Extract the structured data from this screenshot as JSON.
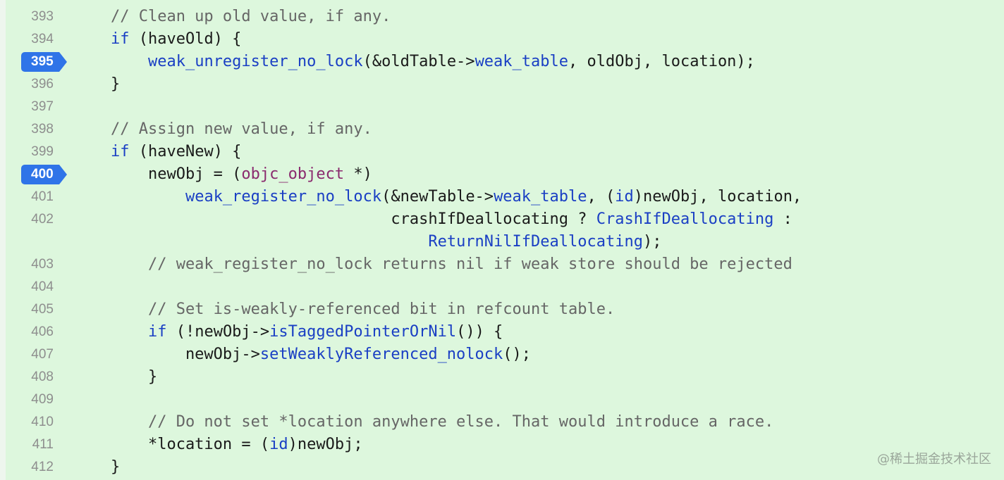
{
  "colors": {
    "background": "#ddf7dd",
    "breakpoint": "#2f74e8",
    "comment": "#666666",
    "keyword": "#1a3fc4",
    "type": "#8a2a6e",
    "line_number": "#8e8e8e"
  },
  "lines": [
    {
      "num": "393",
      "breakpoint": false,
      "tokens": [
        {
          "t": "    // Clean up old value, if any.",
          "c": "cm"
        }
      ]
    },
    {
      "num": "394",
      "breakpoint": false,
      "tokens": [
        {
          "t": "    "
        },
        {
          "t": "if",
          "c": "kw"
        },
        {
          "t": " (haveOld) {"
        }
      ]
    },
    {
      "num": "395",
      "breakpoint": true,
      "tokens": [
        {
          "t": "        "
        },
        {
          "t": "weak_unregister_no_lock",
          "c": "fn"
        },
        {
          "t": "(&oldTable->"
        },
        {
          "t": "weak_table",
          "c": "fn"
        },
        {
          "t": ", oldObj, location);"
        }
      ]
    },
    {
      "num": "396",
      "breakpoint": false,
      "tokens": [
        {
          "t": "    }"
        }
      ]
    },
    {
      "num": "397",
      "breakpoint": false,
      "tokens": []
    },
    {
      "num": "398",
      "breakpoint": false,
      "tokens": [
        {
          "t": "    // Assign new value, if any.",
          "c": "cm"
        }
      ]
    },
    {
      "num": "399",
      "breakpoint": false,
      "tokens": [
        {
          "t": "    "
        },
        {
          "t": "if",
          "c": "kw"
        },
        {
          "t": " (haveNew) {"
        }
      ]
    },
    {
      "num": "400",
      "breakpoint": true,
      "tokens": [
        {
          "t": "        newObj = ("
        },
        {
          "t": "objc_object",
          "c": "ty"
        },
        {
          "t": " *)"
        }
      ]
    },
    {
      "num": "401",
      "breakpoint": false,
      "tokens": [
        {
          "t": "            "
        },
        {
          "t": "weak_register_no_lock",
          "c": "fn"
        },
        {
          "t": "(&newTable->"
        },
        {
          "t": "weak_table",
          "c": "fn"
        },
        {
          "t": ", ("
        },
        {
          "t": "id",
          "c": "kw"
        },
        {
          "t": ")newObj, location,"
        }
      ]
    },
    {
      "num": "402",
      "breakpoint": false,
      "tokens": [
        {
          "t": "                                  crashIfDeallocating ? "
        },
        {
          "t": "CrashIfDeallocating",
          "c": "fn"
        },
        {
          "t": " :"
        }
      ]
    },
    {
      "num": "",
      "breakpoint": false,
      "tokens": [
        {
          "t": "                                      "
        },
        {
          "t": "ReturnNilIfDeallocating",
          "c": "fn"
        },
        {
          "t": ");"
        }
      ]
    },
    {
      "num": "403",
      "breakpoint": false,
      "tokens": [
        {
          "t": "        // weak_register_no_lock returns nil if weak store should be rejected",
          "c": "cm"
        }
      ]
    },
    {
      "num": "404",
      "breakpoint": false,
      "tokens": []
    },
    {
      "num": "405",
      "breakpoint": false,
      "tokens": [
        {
          "t": "        // Set is-weakly-referenced bit in refcount table.",
          "c": "cm"
        }
      ]
    },
    {
      "num": "406",
      "breakpoint": false,
      "tokens": [
        {
          "t": "        "
        },
        {
          "t": "if",
          "c": "kw"
        },
        {
          "t": " (!newObj->"
        },
        {
          "t": "isTaggedPointerOrNil",
          "c": "fn"
        },
        {
          "t": "()) {"
        }
      ]
    },
    {
      "num": "407",
      "breakpoint": false,
      "tokens": [
        {
          "t": "            newObj->"
        },
        {
          "t": "setWeaklyReferenced_nolock",
          "c": "fn"
        },
        {
          "t": "();"
        }
      ]
    },
    {
      "num": "408",
      "breakpoint": false,
      "tokens": [
        {
          "t": "        }"
        }
      ]
    },
    {
      "num": "409",
      "breakpoint": false,
      "tokens": []
    },
    {
      "num": "410",
      "breakpoint": false,
      "tokens": [
        {
          "t": "        // Do not set *location anywhere else. That would introduce a race.",
          "c": "cm"
        }
      ]
    },
    {
      "num": "411",
      "breakpoint": false,
      "tokens": [
        {
          "t": "        *location = ("
        },
        {
          "t": "id",
          "c": "kw"
        },
        {
          "t": ")newObj;"
        }
      ]
    },
    {
      "num": "412",
      "breakpoint": false,
      "tokens": [
        {
          "t": "    }"
        }
      ]
    }
  ],
  "watermark": "@稀土掘金技术社区"
}
